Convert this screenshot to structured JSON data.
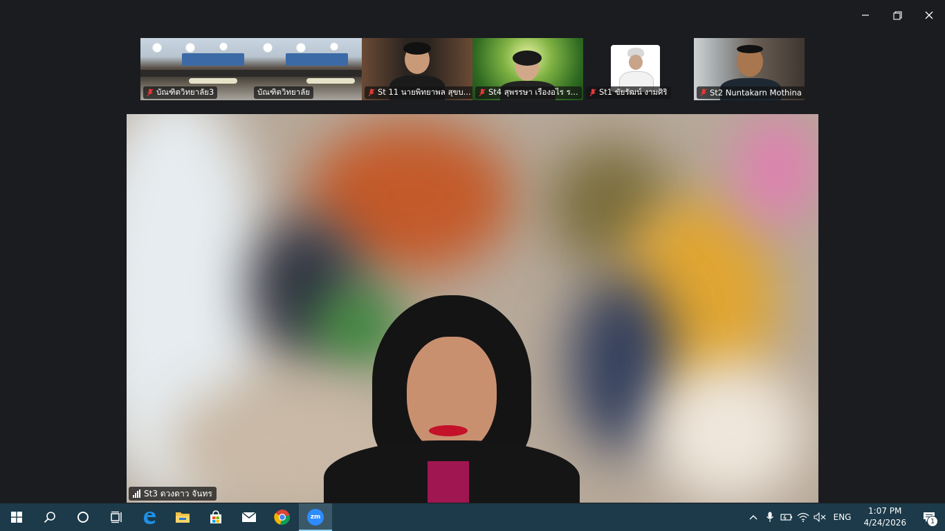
{
  "window": {
    "controls": [
      "minimize-icon",
      "restore-icon",
      "close-icon"
    ]
  },
  "participants": [
    {
      "name": "บัณฑิตวิทยาลัย3",
      "muted": true
    },
    {
      "name": "บัณฑิตวิทยาลัย",
      "muted": false
    },
    {
      "name": "St 11 นายพิทยาพล สุขบ...",
      "muted": true
    },
    {
      "name": "St4 สุพรรษา  เรืองอไร  ร...",
      "muted": true
    },
    {
      "name": "St1 ขัยรัฒน์ งามศิริ",
      "muted": true
    },
    {
      "name": "St2 Nuntakarn Mothina",
      "muted": true
    }
  ],
  "active_speaker": {
    "name": "St3 ดวงดาว จันทร"
  },
  "taskbar": {
    "apps": [
      "windows-start-icon",
      "search-icon",
      "cortana-icon",
      "task-view-icon",
      "edge-icon",
      "file-explorer-icon",
      "store-icon",
      "mail-icon",
      "chrome-icon",
      "zoom-icon"
    ],
    "active_app": "zoom-icon",
    "zoom_label": "zm",
    "language": "ENG",
    "time": "1:07 PM",
    "date": "4/24/2026",
    "notification_count": "1"
  },
  "colors": {
    "taskbar_bg": "#1c3a49",
    "muted_mic": "#e53935",
    "background": "#1a1c20"
  }
}
